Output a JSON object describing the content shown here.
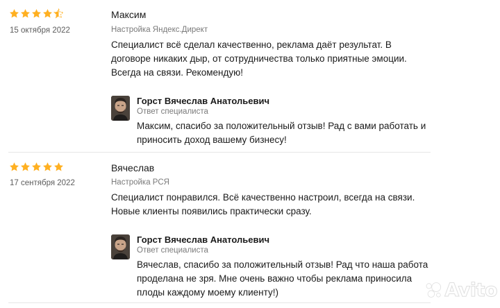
{
  "reviews": [
    {
      "rating": 4.5,
      "date": "15 октября 2022",
      "author": "Максим",
      "category": "Настройка Яндекс.Директ",
      "text": "Специалист всё сделал качественно, реклама даёт результат. В договоре никаких дыр, от сотрудничества только приятные эмоции. Всегда на связи. Рекомендую!",
      "reply": {
        "name": "Горст Вячеслав Анатольевич",
        "role": "Ответ специалиста",
        "text": "Максим, спасибо за положительный отзыв! Рад с вами работать и приносить доход вашему бизнесу!"
      }
    },
    {
      "rating": 5,
      "date": "17 сентября 2022",
      "author": "Вячеслав",
      "category": "Настройка РСЯ",
      "text": "Специалист понравился. Всё качественно настроил, всегда на связи. Новые клиенты появились практически сразу.",
      "reply": {
        "name": "Горст Вячеслав Анатольевич",
        "role": "Ответ специалиста",
        "text": "Вячеслав, спасибо за положительный отзыв! Рад что наша работа проделана не зря. Мне очень важно чтобы реклама приносила плоды каждому моему клиенту!)"
      }
    }
  ],
  "watermark": "Avito",
  "colors": {
    "star": "#ffb021",
    "star_empty": "#e0e0e0",
    "text": "#1a1a1a",
    "muted": "#7a7a7a",
    "divider": "#e6e6e6"
  }
}
